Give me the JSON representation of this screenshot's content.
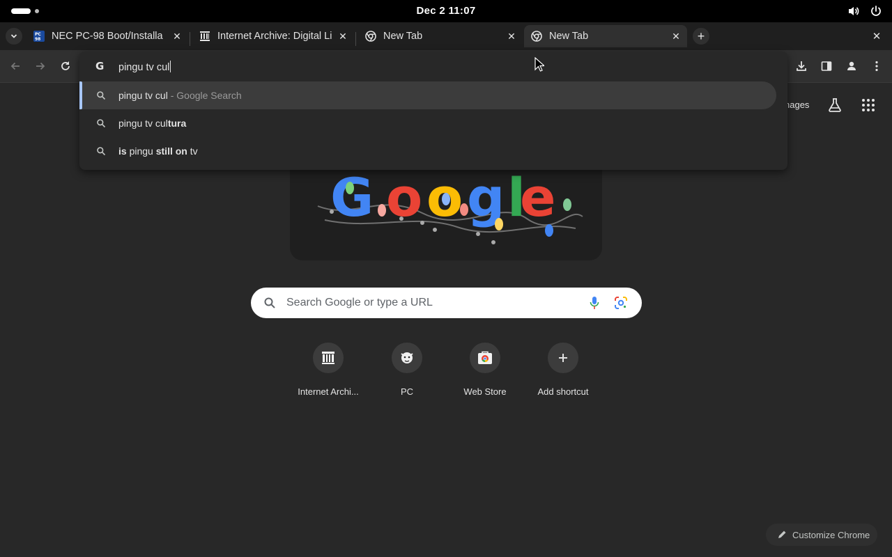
{
  "system": {
    "clock": "Dec 2  11:07",
    "icons": [
      "volume-icon",
      "power-icon"
    ]
  },
  "tabs": [
    {
      "title": "NEC PC-98 Boot/Installa",
      "favicon": "pc98-favicon",
      "active": false
    },
    {
      "title": "Internet Archive: Digital Li",
      "favicon": "archive-favicon",
      "active": false
    },
    {
      "title": "New Tab",
      "favicon": "chrome-favicon",
      "active": false
    },
    {
      "title": "New Tab",
      "favicon": "chrome-favicon",
      "active": true
    }
  ],
  "omnibox": {
    "typed": "pingu tv cul",
    "suggestions": [
      {
        "pre": "pingu tv cul",
        "bold": "",
        "post": "",
        "suffix": " - Google Search",
        "selected": true
      },
      {
        "pre": "pingu tv cul",
        "bold": "tura",
        "post": "",
        "suffix": "",
        "selected": false
      },
      {
        "pre": "",
        "bold": "is",
        "post": " pingu ",
        "bold2": "still on",
        "post2": " tv",
        "suffix": "",
        "selected": false
      }
    ]
  },
  "ntp": {
    "images_link": "nages",
    "search_placeholder": "Search Google or type a URL",
    "shortcuts": [
      {
        "label": "Internet Archi...",
        "icon": "archive-icon"
      },
      {
        "label": "PC",
        "icon": "pc98-icon"
      },
      {
        "label": "Web Store",
        "icon": "webstore-icon"
      },
      {
        "label": "Add shortcut",
        "icon": "plus-icon"
      }
    ],
    "customize_label": "Customize Chrome"
  },
  "colors": {
    "background": "#282828",
    "tabstrip": "#1f1f1f",
    "toolbar": "#303030",
    "selection_accent": "#a8c7fa"
  }
}
